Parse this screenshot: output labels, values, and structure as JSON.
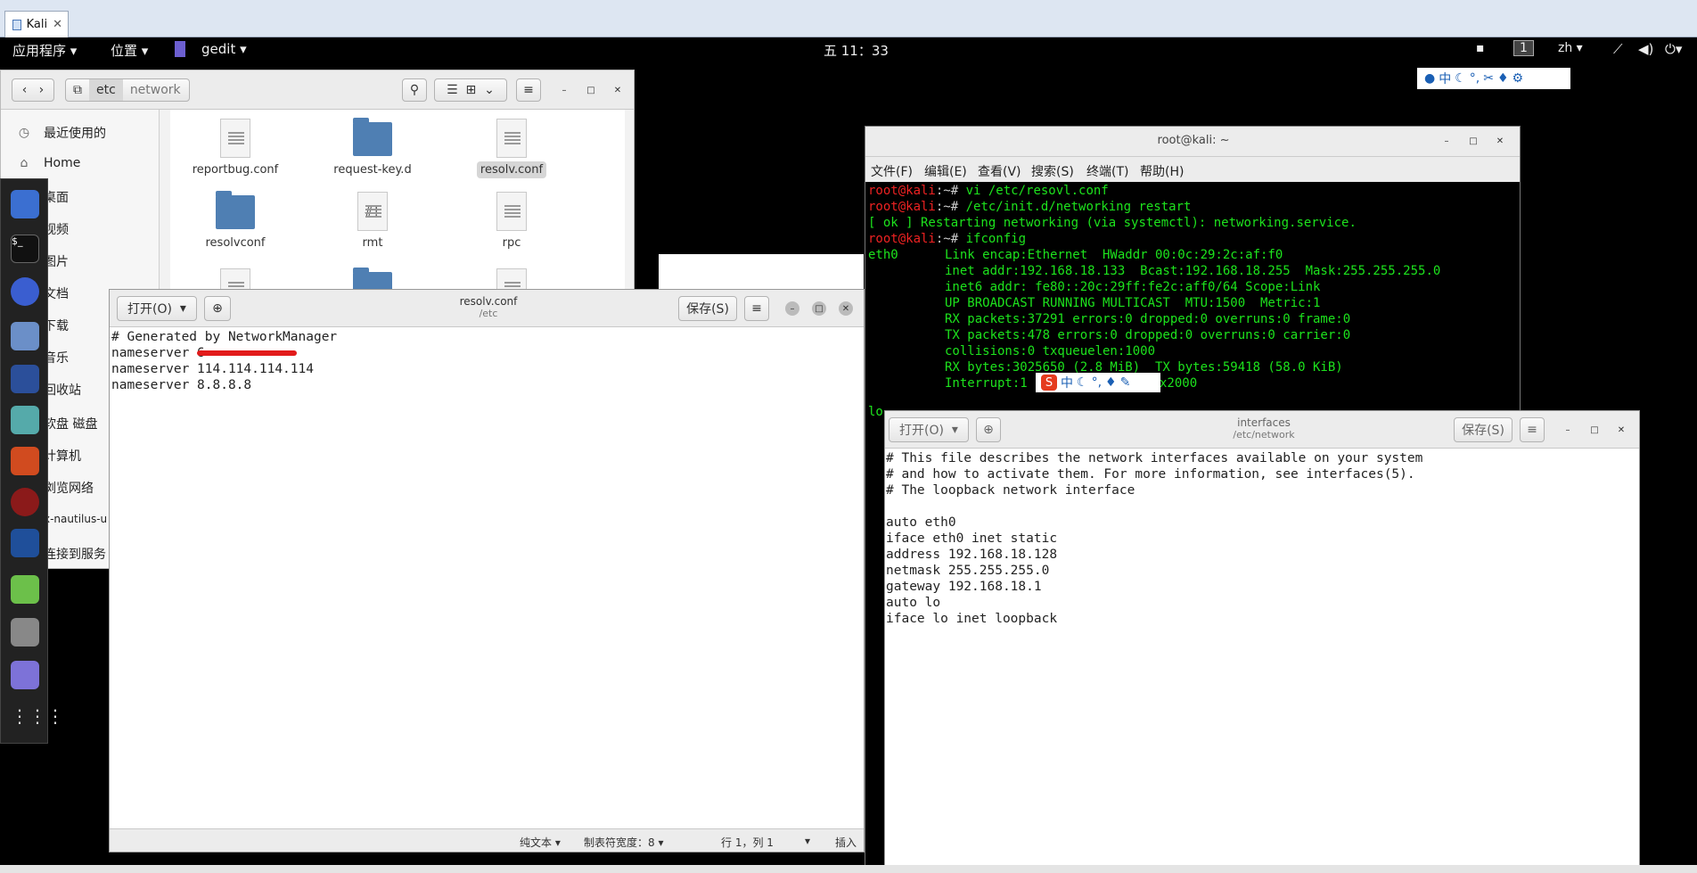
{
  "vm": {
    "tab_label": "Kali"
  },
  "topbar": {
    "apps": "应用程序 ▾",
    "places": "位置 ▾",
    "active_app": "gedit ▾",
    "clock": "五 11：33",
    "workspace": "1",
    "lang": "zh ▾"
  },
  "nautilus": {
    "path": [
      "etc",
      "network"
    ],
    "sidebar": [
      "最近使用的",
      "Home",
      "桌面",
      "视频",
      "图片",
      "文档",
      "下载",
      "音乐",
      "回收站",
      "软盘 磁盘",
      "计算机",
      "浏览网络",
      "x-nautilus-u",
      "连接到服务"
    ],
    "files": [
      "reportbug.conf",
      "request-key.d",
      "resolv.conf",
      "resolvconf",
      "rmt",
      "rpc"
    ],
    "rmt_glyph": "#!"
  },
  "gedit1": {
    "open_label": "打开(O)",
    "save_label": "保存(S)",
    "title": "resolv.conf",
    "subtitle": "/etc",
    "lines": [
      "# Generated by NetworkManager",
      "nameserver 6",
      "nameserver 114.114.114.114",
      "nameserver 8.8.8.8"
    ],
    "status": {
      "lang": "纯文本 ▾",
      "tab": "制表符宽度：8 ▾",
      "pos": "行 1，列 1",
      "mode": "插入"
    }
  },
  "terminal": {
    "title": "root@kali: ~",
    "menu": [
      "文件(F)",
      "编辑(E)",
      "查看(V)",
      "搜索(S)",
      "终端(T)",
      "帮助(H)"
    ],
    "prompt": "root@kali",
    "path": ":~#",
    "cmd1": " vi /etc/resovl.conf",
    "cmd2": " /etc/init.d/networking restart",
    "ok": "[ ok ]",
    "ok_msg": " Restarting networking (via systemctl): networking.service.",
    "cmd3": " ifconfig",
    "iface": "eth0",
    "if_lines": [
      "Link encap:Ethernet  HWaddr 00:0c:29:2c:af:f0",
      "inet addr:192.168.18.133  Bcast:192.168.18.255  Mask:255.255.255.0",
      "inet6 addr: fe80::20c:29ff:fe2c:aff0/64 Scope:Link",
      "UP BROADCAST RUNNING MULTICAST  MTU:1500  Metric:1",
      "RX packets:37291 errors:0 dropped:0 overruns:0 frame:0",
      "TX packets:478 errors:0 dropped:0 overruns:0 carrier:0",
      "collisions:0 txqueuelen:1000",
      "RX bytes:3025650 (2.8 MiB)  TX bytes:59418 (58.0 KiB)",
      "Interrupt:1",
      "x2000"
    ],
    "lo_stub": "lo"
  },
  "gedit2": {
    "open_label": "打开(O)",
    "save_label": "保存(S)",
    "title": "interfaces",
    "subtitle": "/etc/network",
    "lines": [
      "# This file describes the network interfaces available on your system",
      "# and how to activate them. For more information, see interfaces(5).",
      "# The loopback network interface",
      "",
      "auto eth0",
      "iface eth0 inet static",
      "address 192.168.18.128",
      "netmask 255.255.255.0",
      "gateway 192.168.18.1",
      "auto lo",
      "iface lo inet loopback"
    ]
  },
  "ime": {
    "zh": "中"
  },
  "colors": {
    "terminal_green": "#1de31d",
    "prompt_red": "#e22",
    "folder_blue": "#4f7fb3"
  }
}
